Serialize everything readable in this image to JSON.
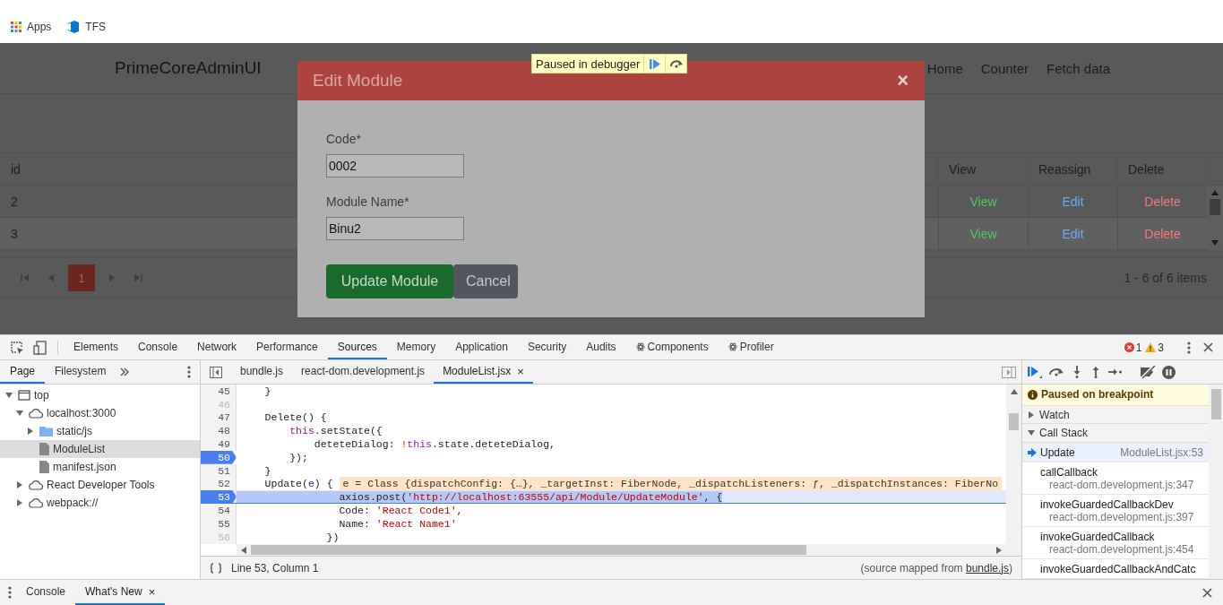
{
  "bookmarks": [
    {
      "label": "Apps",
      "kind": "apps"
    },
    {
      "label": "TFS",
      "kind": "tfs"
    }
  ],
  "app": {
    "brand": "PrimeCoreAdminUI",
    "nav": [
      {
        "label": "Home"
      },
      {
        "label": "Counter"
      },
      {
        "label": "Fetch data"
      }
    ],
    "table": {
      "columns": [
        "id",
        "View",
        "Reassign",
        "Delete"
      ],
      "rows": [
        {
          "id": "2",
          "view": "View",
          "reassign": "Edit",
          "delete": "Delete"
        },
        {
          "id": "3",
          "view": "View",
          "reassign": "Edit",
          "delete": "Delete"
        }
      ]
    },
    "pager": {
      "pages": [
        {
          "label": "1",
          "selected": true
        }
      ],
      "summary": "1 - 6 of 6 items"
    },
    "modal": {
      "title": "Edit Module",
      "close": "×",
      "fields": [
        {
          "label": "Code*",
          "value": "0002"
        },
        {
          "label": "Module Name*",
          "value": "Binu2"
        }
      ],
      "buttons": [
        {
          "label": "Update Module",
          "kind": "primary"
        },
        {
          "label": "Cancel",
          "kind": "secondary"
        }
      ]
    }
  },
  "paused_overlay": {
    "label": "Paused in debugger"
  },
  "devtools": {
    "tabs": [
      {
        "label": "Elements",
        "selected": false,
        "kind": "plain"
      },
      {
        "label": "Console",
        "selected": false,
        "kind": "plain"
      },
      {
        "label": "Network",
        "selected": false,
        "kind": "plain"
      },
      {
        "label": "Performance",
        "selected": false,
        "kind": "plain"
      },
      {
        "label": "Sources",
        "selected": true,
        "kind": "plain"
      },
      {
        "label": "Memory",
        "selected": false,
        "kind": "plain"
      },
      {
        "label": "Application",
        "selected": false,
        "kind": "plain"
      },
      {
        "label": "Security",
        "selected": false,
        "kind": "plain"
      },
      {
        "label": "Audits",
        "selected": false,
        "kind": "plain"
      },
      {
        "label": "Components",
        "selected": false,
        "kind": "react"
      },
      {
        "label": "Profiler",
        "selected": false,
        "kind": "react"
      }
    ],
    "errors": "1",
    "warnings": "3",
    "navigator_tabs": [
      {
        "label": "Page",
        "selected": true
      },
      {
        "label": "Filesystem",
        "selected": false
      }
    ],
    "tree": [
      {
        "label": "top",
        "kind": "frame",
        "expanded": true,
        "selected": false,
        "children": [
          {
            "label": "localhost:3000",
            "kind": "origin",
            "expanded": true,
            "selected": false,
            "children": [
              {
                "label": "static/js",
                "kind": "folder",
                "expanded": false,
                "selected": false
              },
              {
                "label": "ModuleList",
                "kind": "file",
                "selected": true
              },
              {
                "label": "manifest.json",
                "kind": "file",
                "selected": false
              }
            ]
          },
          {
            "label": "React Developer Tools",
            "kind": "origin",
            "expanded": false,
            "selected": false
          },
          {
            "label": "webpack://",
            "kind": "origin",
            "expanded": false,
            "selected": false
          }
        ]
      }
    ],
    "editor_tabs": [
      {
        "label": "bundle.js",
        "selected": false
      },
      {
        "label": "react-dom.development.js",
        "selected": false
      },
      {
        "label": "ModuleList.jsx",
        "selected": true,
        "close": "×"
      }
    ],
    "lines": [
      {
        "number": "45",
        "mapped": true,
        "breakpoint": false,
        "current": false,
        "tokens": [
          {
            "text": "    }",
            "kind": "plain"
          }
        ]
      },
      {
        "number": "46",
        "mapped": false,
        "breakpoint": false,
        "current": false
      },
      {
        "number": "47",
        "mapped": true,
        "breakpoint": false,
        "current": false,
        "tokens": [
          {
            "text": "    Delete() {",
            "kind": "plain"
          }
        ]
      },
      {
        "number": "48",
        "mapped": true,
        "breakpoint": false,
        "current": false,
        "tokens": [
          {
            "text": "        this",
            "kind": "keyword"
          },
          {
            "text": ".setState({",
            "kind": "plain"
          }
        ]
      },
      {
        "number": "49",
        "mapped": true,
        "breakpoint": false,
        "current": false,
        "tokens": [
          {
            "text": "            deteteDialog: ",
            "kind": "plain"
          },
          {
            "text": "!",
            "kind": "operator"
          },
          {
            "text": "this",
            "kind": "keyword"
          },
          {
            "text": ".state.deteteDialog,",
            "kind": "plain"
          }
        ]
      },
      {
        "number": "50",
        "mapped": true,
        "breakpoint": true,
        "current": false,
        "tokens": [
          {
            "text": "        });",
            "kind": "plain"
          }
        ]
      },
      {
        "number": "51",
        "mapped": true,
        "breakpoint": false,
        "current": false,
        "tokens": [
          {
            "text": "    }",
            "kind": "plain"
          }
        ]
      },
      {
        "number": "52",
        "mapped": true,
        "breakpoint": false,
        "current": false,
        "tokens": [
          {
            "text": "    Update(",
            "kind": "plain"
          },
          {
            "text": "e",
            "kind": "param"
          },
          {
            "text": ") {",
            "kind": "plain"
          }
        ],
        "inline_value": "e = Class {dispatchConfig: {…}, _targetInst: FiberNode, _dispatchListeners: ƒ, _dispatchInstances: FiberNo"
      },
      {
        "number": "53",
        "mapped": true,
        "breakpoint": true,
        "current": true,
        "tokens": [
          {
            "text": "                axios.post(",
            "kind": "plain"
          },
          {
            "text": "'http://localhost:63555/api/Module/UpdateModule'",
            "kind": "string"
          },
          {
            "text": ", {",
            "kind": "plain"
          }
        ]
      },
      {
        "number": "54",
        "mapped": true,
        "breakpoint": false,
        "current": false,
        "tokens": [
          {
            "text": "                Code: ",
            "kind": "plain"
          },
          {
            "text": "'React Code1'",
            "kind": "string"
          },
          {
            "text": ",",
            "kind": "plain"
          }
        ]
      },
      {
        "number": "55",
        "mapped": true,
        "breakpoint": false,
        "current": false,
        "tokens": [
          {
            "text": "                Name: ",
            "kind": "plain"
          },
          {
            "text": "'React Name1'",
            "kind": "string"
          }
        ]
      },
      {
        "number": "56",
        "mapped": false,
        "breakpoint": false,
        "current": false,
        "tokens": [
          {
            "text": "              })",
            "kind": "plain"
          }
        ]
      }
    ],
    "position": "Line 53, Column 1",
    "source_mapped": {
      "prefix": "(source mapped from ",
      "link": "bundle.js",
      "suffix": ")"
    },
    "banner": "Paused on breakpoint",
    "sections": [
      {
        "title": "Watch",
        "expanded": false
      },
      {
        "title": "Call Stack",
        "expanded": true
      }
    ],
    "frames": [
      {
        "name": "Update",
        "location": "ModuleList.jsx:53",
        "selected": true,
        "kind": "inline"
      },
      {
        "name": "callCallback",
        "location": "react-dom.development.js:347",
        "selected": false,
        "kind": "stacked"
      },
      {
        "name": "invokeGuardedCallbackDev",
        "location": "react-dom.development.js:397",
        "selected": false,
        "kind": "stacked"
      },
      {
        "name": "invokeGuardedCallback",
        "location": "react-dom.development.js:454",
        "selected": false,
        "kind": "stacked"
      },
      {
        "name": "invokeGuardedCallbackAndCatc",
        "selected": false,
        "kind": "cut"
      }
    ],
    "drawer_tabs": [
      {
        "label": "Console",
        "selected": false
      },
      {
        "label": "What's New",
        "selected": true,
        "close": "×"
      }
    ]
  }
}
